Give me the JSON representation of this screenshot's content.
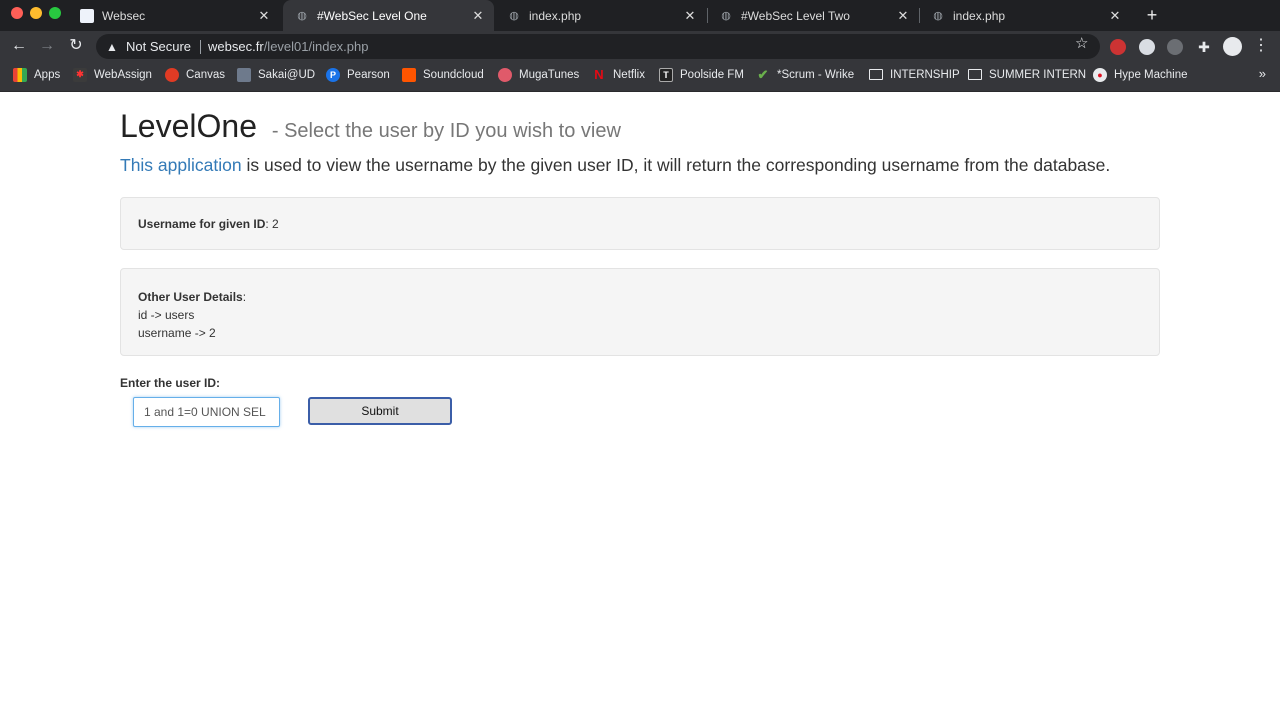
{
  "browser": {
    "tabs": [
      {
        "title": "Websec",
        "active": false
      },
      {
        "title": "#WebSec Level One",
        "active": true
      },
      {
        "title": "index.php",
        "active": false
      },
      {
        "title": "#WebSec Level Two",
        "active": false
      },
      {
        "title": "index.php",
        "active": false
      }
    ],
    "new_tab": "+",
    "security_label": "Not Secure",
    "url_host": "websec.fr",
    "url_path": "/level01/index.php",
    "bookmarks": [
      {
        "label": "Apps",
        "icon": "apps-grid-icon"
      },
      {
        "label": "WebAssign",
        "icon": "webassign-icon"
      },
      {
        "label": "Canvas",
        "icon": "canvas-icon"
      },
      {
        "label": "Sakai@UD",
        "icon": "sakai-icon"
      },
      {
        "label": "Pearson",
        "icon": "pearson-icon"
      },
      {
        "label": "Soundcloud",
        "icon": "soundcloud-icon"
      },
      {
        "label": "MugaTunes",
        "icon": "mugatunes-icon"
      },
      {
        "label": "Netflix",
        "icon": "netflix-icon"
      },
      {
        "label": "Poolside FM",
        "icon": "poolside-icon"
      },
      {
        "label": "*Scrum - Wrike",
        "icon": "wrike-check-icon"
      },
      {
        "label": "INTERNSHIP",
        "icon": "folder-icon"
      },
      {
        "label": "SUMMER INTERN",
        "icon": "folder-icon"
      },
      {
        "label": "Hype Machine",
        "icon": "hype-machine-icon"
      }
    ],
    "more": "»"
  },
  "page": {
    "title": "LevelOne",
    "subtitle": "- Select the user by ID you wish to view",
    "lead_link": "This application",
    "lead_rest": " is used to view the username by the given user ID, it will return the corresponding username from the database.",
    "result": {
      "label": "Username for given ID",
      "value": ": 2"
    },
    "details": {
      "label": "Other User Details",
      "colon": ":",
      "line1": "id -> users",
      "line2": "username -> 2"
    },
    "form": {
      "label": "Enter the user ID:",
      "input_value": "1 and 1=0 UNION SEL",
      "submit": "Submit"
    }
  }
}
